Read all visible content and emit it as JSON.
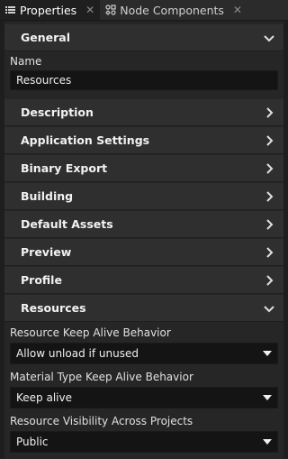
{
  "tabs": [
    {
      "label": "Properties",
      "icon": "list-icon",
      "active": true
    },
    {
      "label": "Node Components",
      "icon": "node-components-icon",
      "active": false
    }
  ],
  "general": {
    "title": "General",
    "name_label": "Name",
    "name_value": "Resources"
  },
  "sections": [
    {
      "label": "Description",
      "expanded": false
    },
    {
      "label": "Application Settings",
      "expanded": false
    },
    {
      "label": "Binary Export",
      "expanded": false
    },
    {
      "label": "Building",
      "expanded": false
    },
    {
      "label": "Default Assets",
      "expanded": false
    },
    {
      "label": "Preview",
      "expanded": false
    },
    {
      "label": "Profile",
      "expanded": false
    }
  ],
  "resources": {
    "title": "Resources",
    "keep_alive_label": "Resource Keep Alive Behavior",
    "keep_alive_value": "Allow unload if unused",
    "material_label": "Material Type Keep Alive Behavior",
    "material_value": "Keep alive",
    "visibility_label": "Resource Visibility Across Projects",
    "visibility_value": "Public"
  }
}
